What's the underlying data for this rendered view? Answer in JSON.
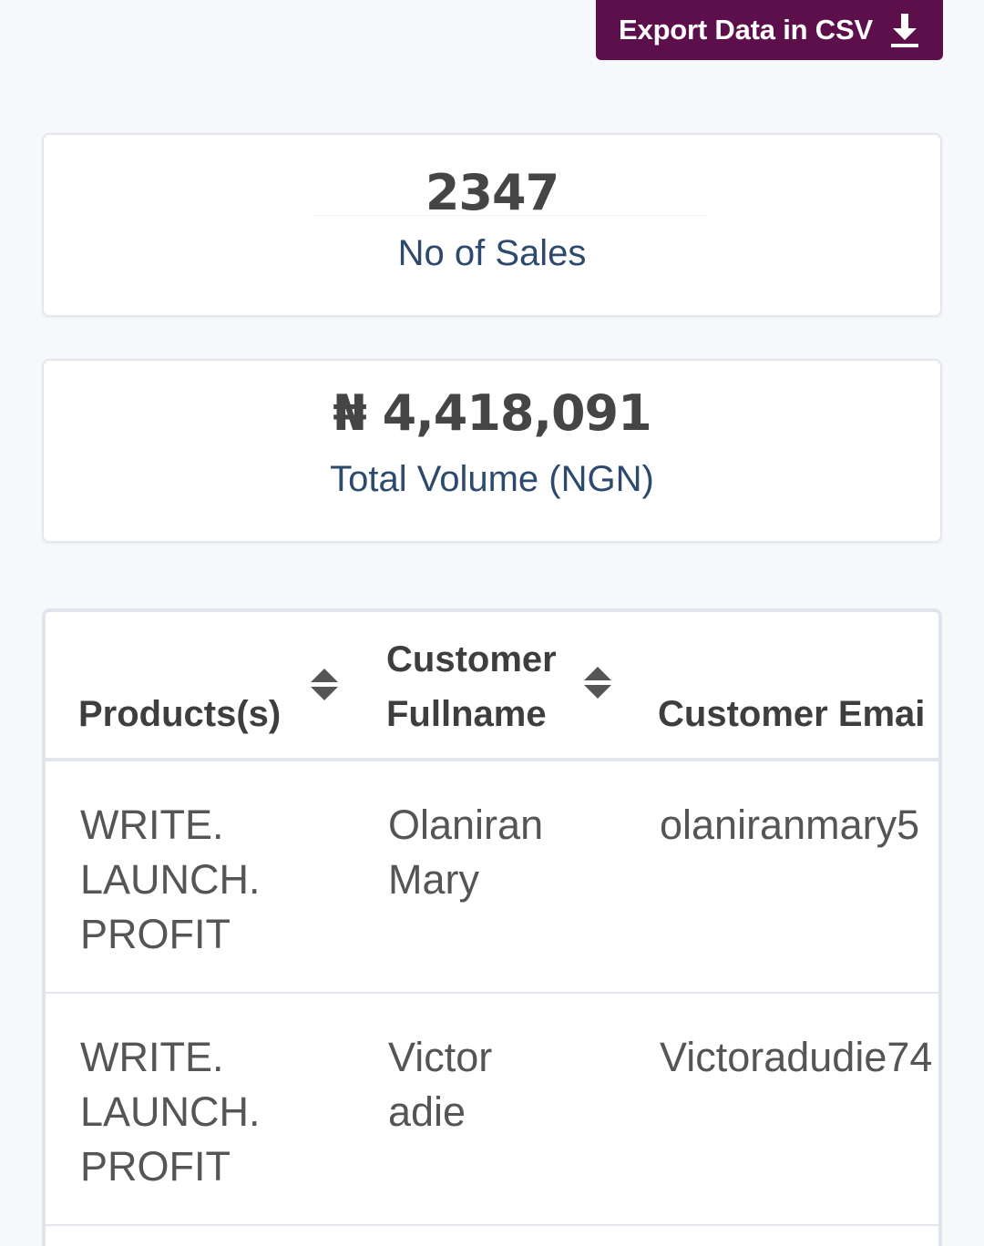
{
  "header": {
    "export_label": "Export Data in CSV",
    "export_icon": "download-icon"
  },
  "stats": {
    "sales": {
      "value": "2347",
      "label": "No of Sales"
    },
    "volume": {
      "value": "₦ 4,418,091",
      "label": "Total Volume (NGN)"
    }
  },
  "table": {
    "columns": [
      {
        "label": "Products(s)",
        "sortable": true
      },
      {
        "label": "Customer\nFullname",
        "sortable": true
      },
      {
        "label": "Customer Emai",
        "sortable": false
      }
    ],
    "rows": [
      {
        "product": "WRITE.\nLAUNCH.\nPROFIT",
        "fullname": "Olaniran\nMary",
        "email": "olaniranmary5"
      },
      {
        "product": "WRITE.\nLAUNCH.\nPROFIT",
        "fullname": "Victor\nadie",
        "email": "Victoradudie74"
      }
    ]
  },
  "colors": {
    "accent": "#5c0f4a",
    "caption": "#2d4a6e",
    "background": "#f7f8fc"
  }
}
